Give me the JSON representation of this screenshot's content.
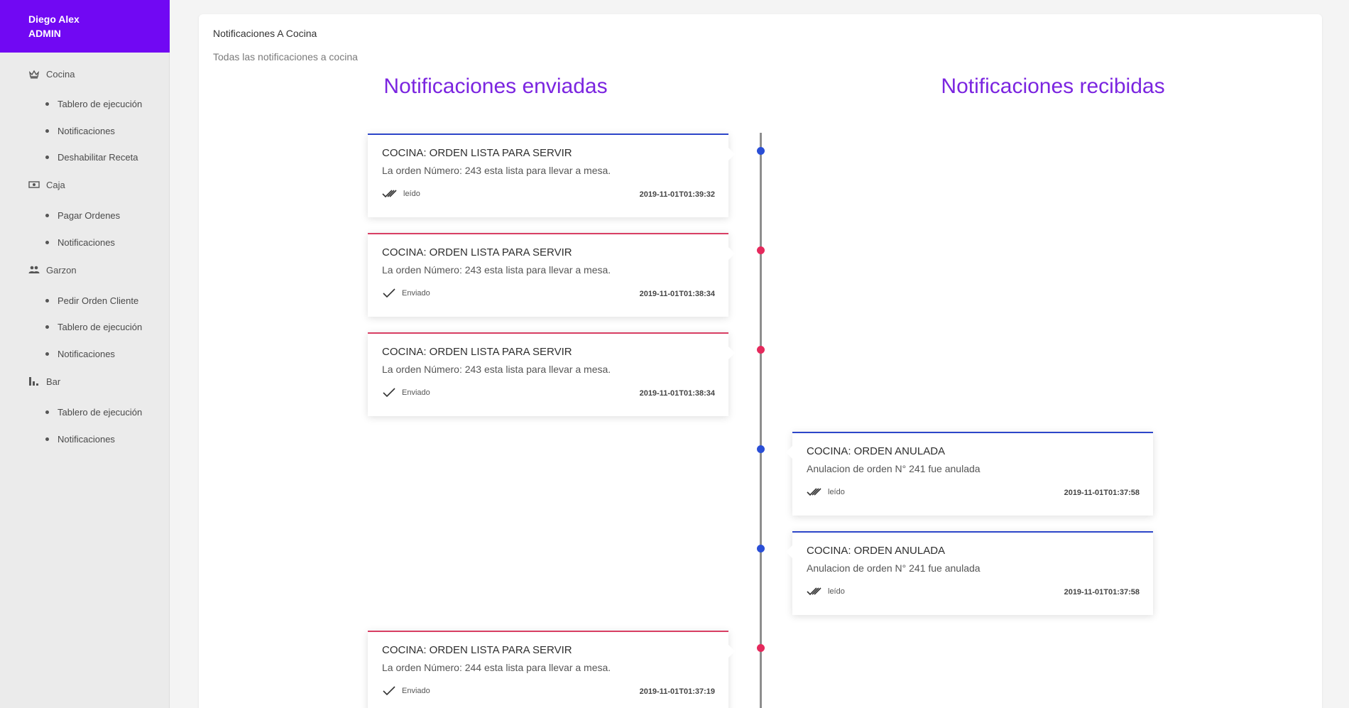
{
  "user": {
    "name": "Diego Alex",
    "role": "ADMIN"
  },
  "sidebar": {
    "sections": [
      {
        "label": "Cocina",
        "icon": "crown-icon",
        "items": [
          "Tablero de ejecución",
          "Notificaciones",
          "Deshabilitar Receta"
        ]
      },
      {
        "label": "Caja",
        "icon": "money-icon",
        "items": [
          "Pagar Ordenes",
          "Notificaciones"
        ]
      },
      {
        "label": "Garzon",
        "icon": "people-icon",
        "items": [
          "Pedir Orden Cliente",
          "Tablero de ejecución",
          "Notificaciones"
        ]
      },
      {
        "label": "Bar",
        "icon": "bar-icon",
        "items": [
          "Tablero de ejecución",
          "Notificaciones"
        ]
      }
    ]
  },
  "panel": {
    "title": "Notificaciones A Cocina",
    "subtitle": "Todas las notificaciones a cocina",
    "sent_title": "Notificaciones enviadas",
    "received_title": "Notificaciones recibidas"
  },
  "notifications": [
    {
      "side": "left",
      "color": "blue",
      "title": "COCINA: ORDEN LISTA PARA SERVIR",
      "body": "La orden Número: 243 esta lista para llevar a mesa.",
      "status": "leído",
      "status_icon": "double-check-icon",
      "time": "2019-11-01T01:39:32"
    },
    {
      "side": "left",
      "color": "red",
      "title": "COCINA: ORDEN LISTA PARA SERVIR",
      "body": "La orden Número: 243 esta lista para llevar a mesa.",
      "status": "Enviado",
      "status_icon": "check-icon",
      "time": "2019-11-01T01:38:34"
    },
    {
      "side": "left",
      "color": "red",
      "title": "COCINA: ORDEN LISTA PARA SERVIR",
      "body": "La orden Número: 243 esta lista para llevar a mesa.",
      "status": "Enviado",
      "status_icon": "check-icon",
      "time": "2019-11-01T01:38:34"
    },
    {
      "side": "right",
      "color": "blue",
      "title": "COCINA: ORDEN ANULADA",
      "body": "Anulacion de orden N° 241 fue anulada",
      "status": "leído",
      "status_icon": "double-check-icon",
      "time": "2019-11-01T01:37:58"
    },
    {
      "side": "right",
      "color": "blue",
      "title": "COCINA: ORDEN ANULADA",
      "body": "Anulacion de orden N° 241 fue anulada",
      "status": "leído",
      "status_icon": "double-check-icon",
      "time": "2019-11-01T01:37:58"
    },
    {
      "side": "left",
      "color": "red",
      "title": "COCINA: ORDEN LISTA PARA SERVIR",
      "body": "La orden Número: 244 esta lista para llevar a mesa.",
      "status": "Enviado",
      "status_icon": "check-icon",
      "time": "2019-11-01T01:37:19"
    }
  ],
  "colors": {
    "accent": "#7108f3",
    "heading": "#7b25e0",
    "blue": "#2a4ed6",
    "red": "#e5295c"
  }
}
